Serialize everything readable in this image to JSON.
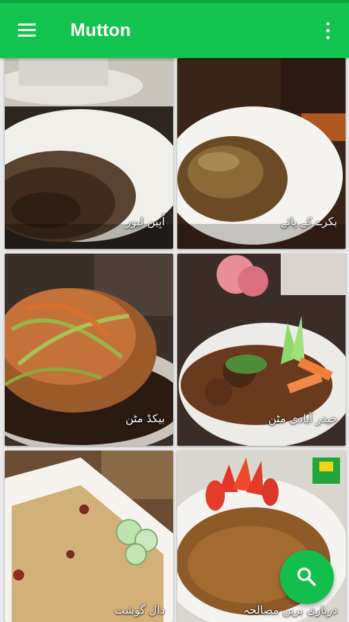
{
  "app_bar": {
    "title": "Mutton",
    "menu_icon": "hamburger-menu-icon",
    "more_icon": "more-vertical-icon"
  },
  "recipes": [
    {
      "name": "اُبِین لیور"
    },
    {
      "name": "بکرے کے پائے"
    },
    {
      "name": "بیکڈ مٹن"
    },
    {
      "name": "حیدر آبادی مٹن"
    },
    {
      "name": "دال گوشت"
    },
    {
      "name": "درباری برین مصالحہ"
    }
  ],
  "fab": {
    "icon": "search-icon"
  },
  "colors": {
    "primary": "#12c44f",
    "status_bar": "#0aa23f",
    "fab": "#13bf4c"
  }
}
